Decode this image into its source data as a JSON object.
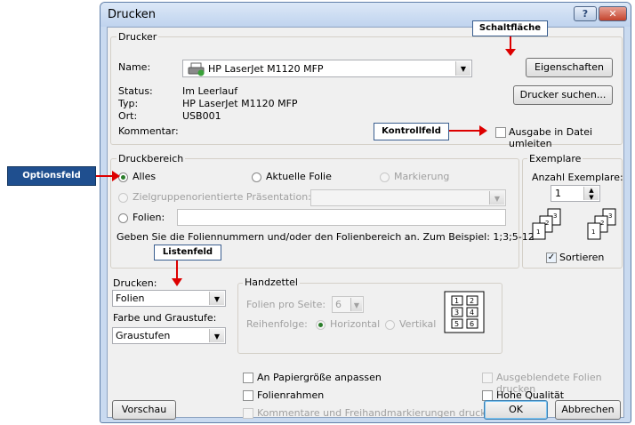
{
  "dialog": {
    "title": "Drucken",
    "help_symbol": "?",
    "close_symbol": "✕"
  },
  "printer": {
    "group_label": "Drucker",
    "name_label": "Name:",
    "name_value": "HP LaserJet M1120 MFP",
    "status_label": "Status:",
    "status_value": "Im Leerlauf",
    "type_label": "Typ:",
    "type_value": "HP LaserJet M1120 MFP",
    "location_label": "Ort:",
    "location_value": "USB001",
    "comment_label": "Kommentar:",
    "properties_button": "Eigenschaften",
    "find_printer_button": "Drucker suchen...",
    "print_to_file_label": "Ausgabe in Datei umleiten"
  },
  "print_range": {
    "group_label": "Druckbereich",
    "all_label": "Alles",
    "current_slide_label": "Aktuelle Folie",
    "selection_label": "Markierung",
    "custom_show_label": "Zielgruppenorientierte Präsentation:",
    "slides_label": "Folien:",
    "hint": "Geben Sie die Foliennummern und/oder den Folienbereich an. Zum Beispiel: 1;3;5-12"
  },
  "copies": {
    "group_label": "Exemplare",
    "count_label": "Anzahl Exemplare:",
    "count_value": "1",
    "collate_label": "Sortieren",
    "page_numbers": [
      "1",
      "2",
      "3"
    ]
  },
  "print_what": {
    "label": "Drucken:",
    "value": "Folien",
    "color_label": "Farbe und Graustufe:",
    "color_value": "Graustufen"
  },
  "handouts": {
    "group_label": "Handzettel",
    "per_page_label": "Folien pro Seite:",
    "per_page_value": "6",
    "order_label": "Reihenfolge:",
    "horizontal_label": "Horizontal",
    "vertical_label": "Vertikal",
    "thumb_numbers": [
      "1",
      "2",
      "3",
      "4",
      "5",
      "6"
    ]
  },
  "options": {
    "fit_to_paper": "An Papiergröße anpassen",
    "frame_slides": "Folienrahmen",
    "print_comments": "Kommentare und Freihandmarkierungen drucken",
    "print_hidden": "Ausgeblendete Folien drucken",
    "high_quality": "Hohe Qualität"
  },
  "footer": {
    "preview_button": "Vorschau",
    "ok_button": "OK",
    "cancel_button": "Abbrechen"
  },
  "annotations": {
    "button": "Schaltfläche",
    "checkbox": "Kontrollfeld",
    "radio": "Optionsfeld",
    "listbox": "Listenfeld"
  },
  "colors": {
    "annotation_bg": "#1f4f8f",
    "arrow": "#dd0000",
    "dialog_frame": "#c9daf0"
  }
}
